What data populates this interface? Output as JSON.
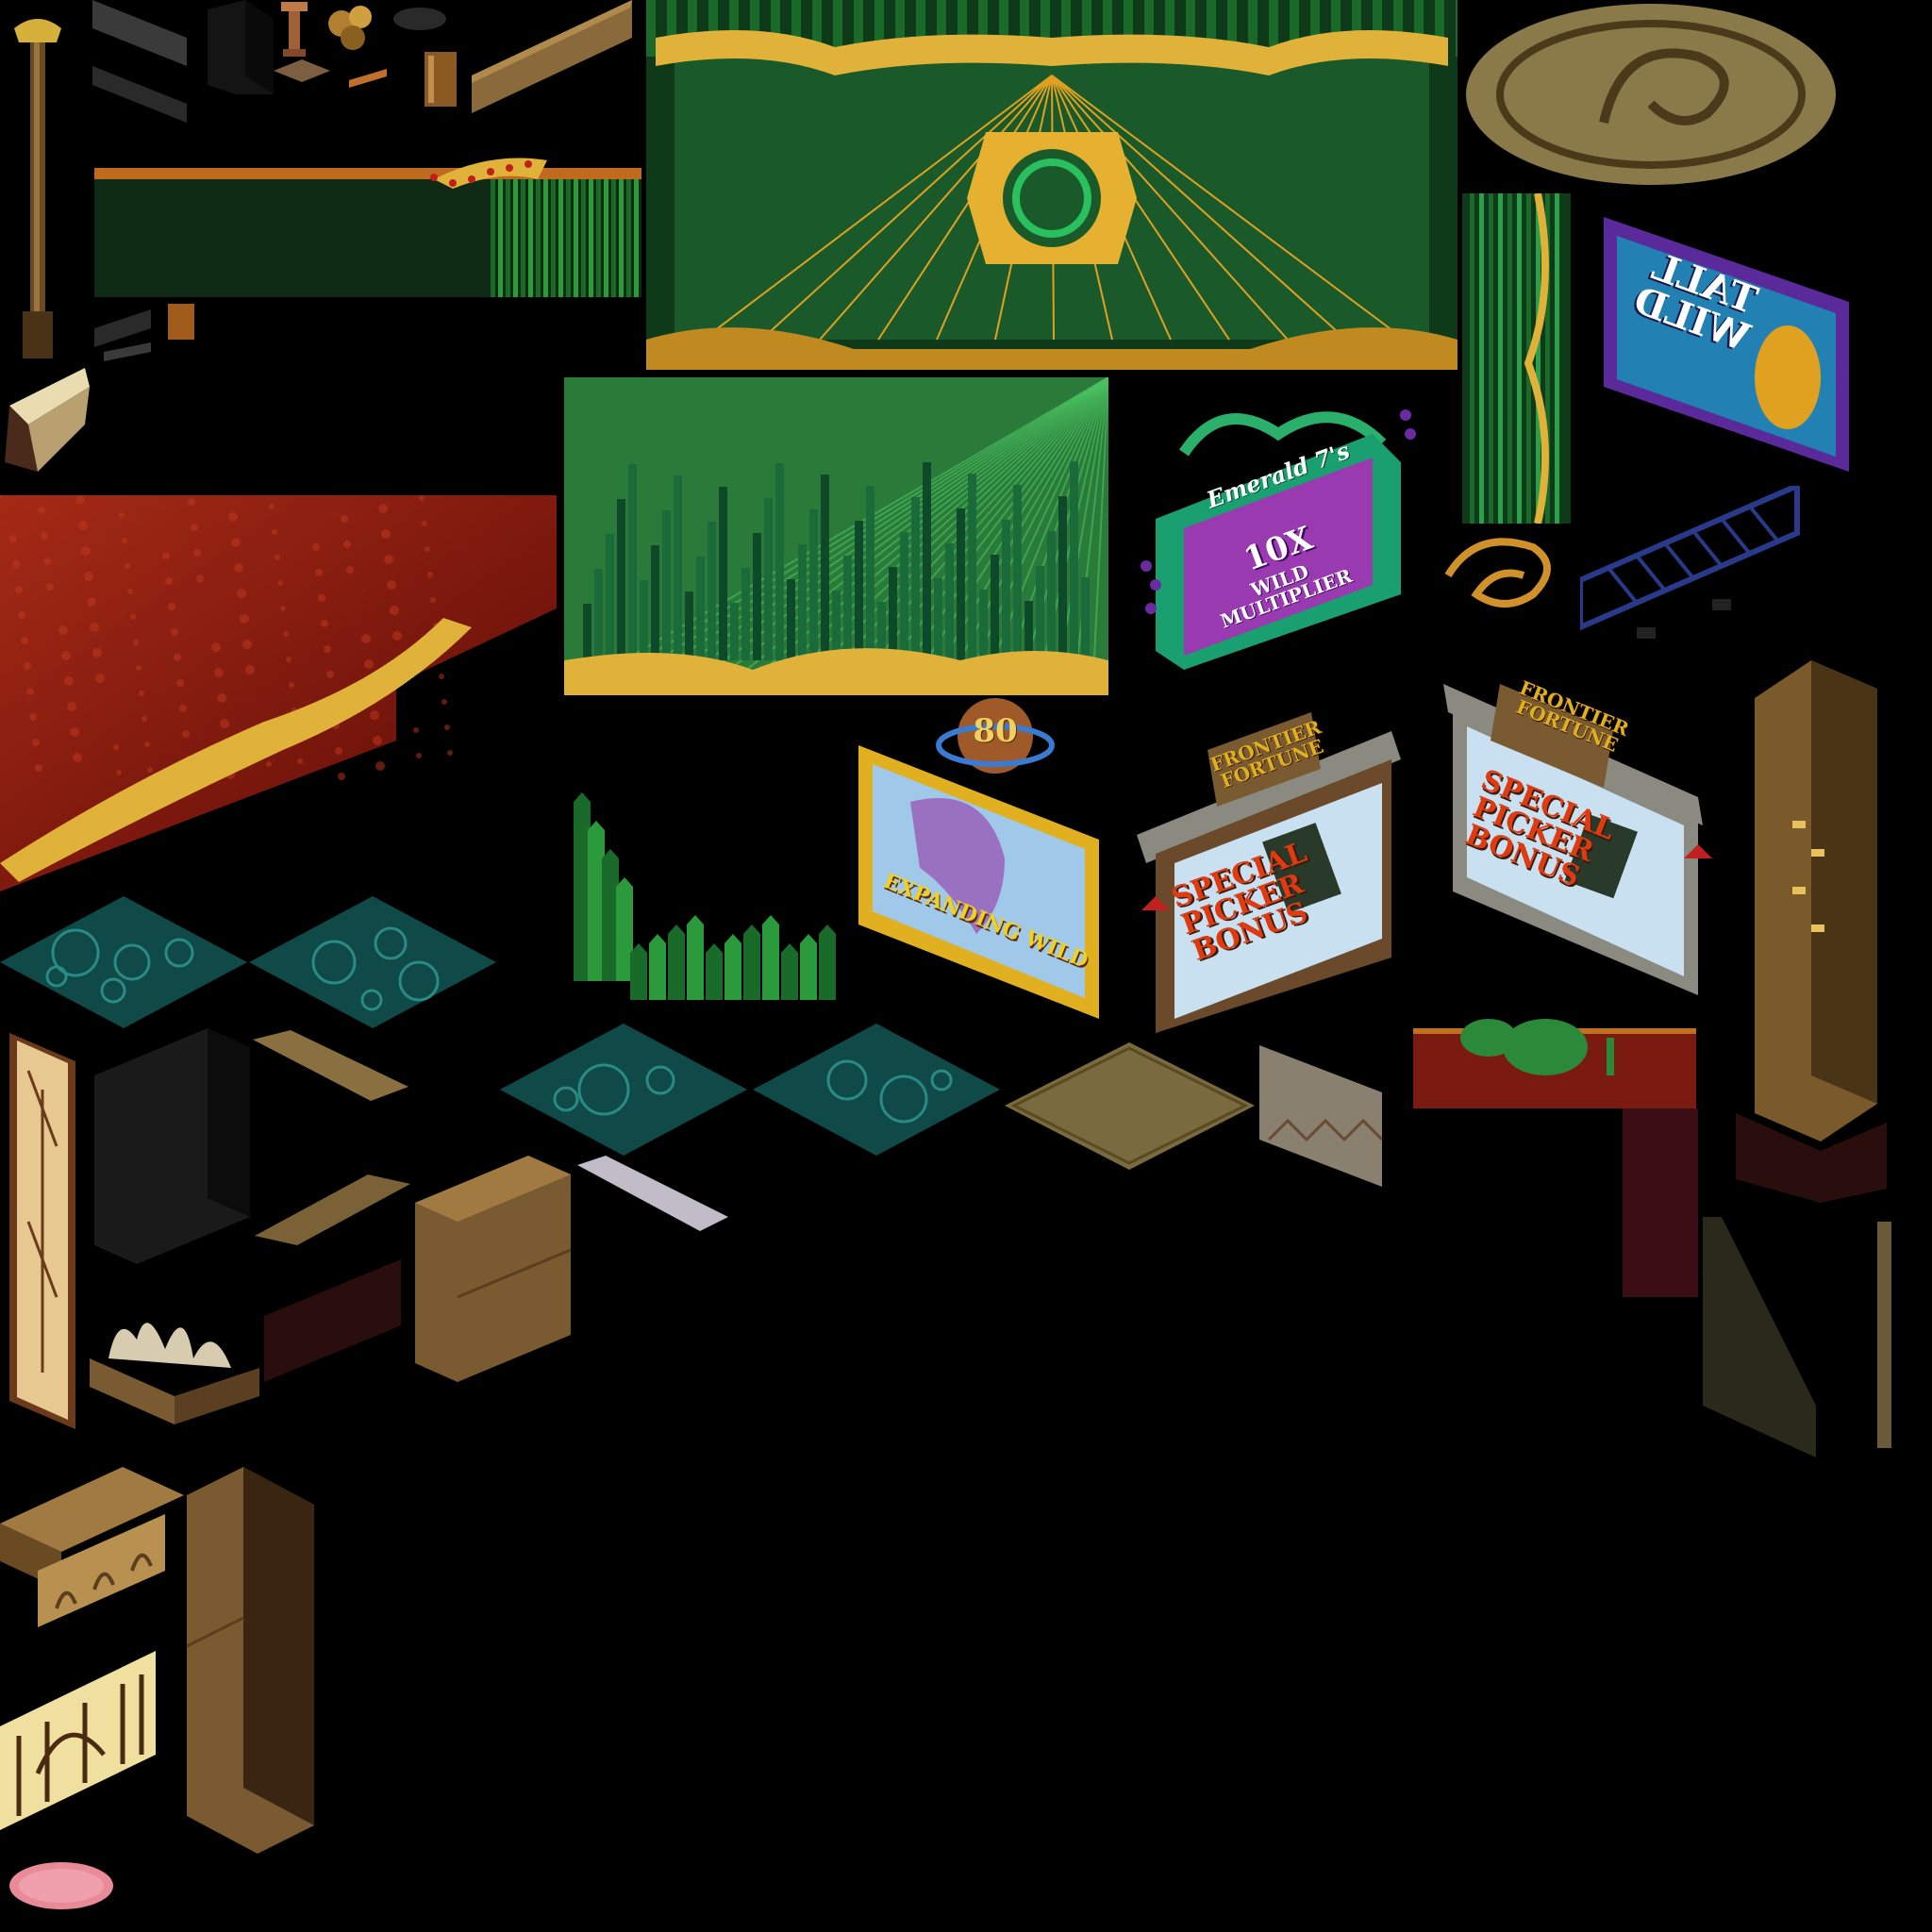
{
  "atlas": {
    "signs": {
      "emerald_title": "Emerald 7's",
      "wild_multiplier_value": "10X",
      "wild_multiplier_label": "WILD MULTIPLIER",
      "tall_wild": "TALL WILD",
      "balloon_number": "80",
      "expanding_wild": "EXPANDING WILD",
      "frontier_title": "FRONTIER FORTUNE",
      "special_picker_bonus": "SPECIAL PICKER BONUS"
    },
    "colors": {
      "background": "#000000",
      "emerald": "#1f7a3a",
      "gold": "#e0b23a",
      "red_carpet": "#8e1a10",
      "teal_tile": "#0f4a48",
      "wood": "#7a5a30",
      "purple_frame": "#6b3fb0"
    }
  }
}
